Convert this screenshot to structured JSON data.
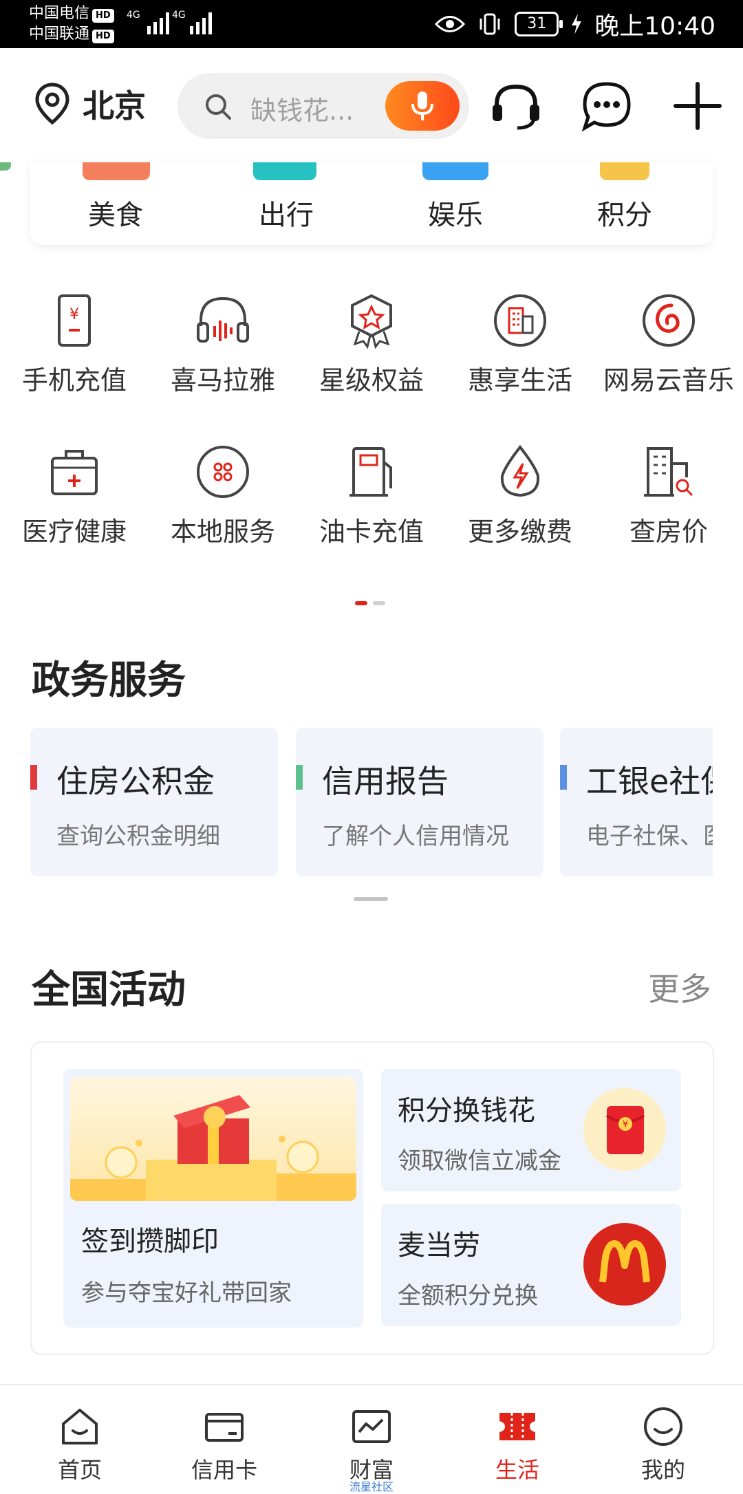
{
  "status_bar": {
    "carrier1": "中国电信",
    "carrier2": "中国联通",
    "hd": "HD",
    "net1": "4G",
    "net2": "4G",
    "battery": "31",
    "time": "晚上10:40"
  },
  "header": {
    "location": "北京",
    "search_placeholder": "缺钱花...",
    "icons": [
      "location-pin-icon",
      "search-icon",
      "mic-icon",
      "headset-icon",
      "chat-bubble-icon",
      "plus-icon"
    ]
  },
  "top_categories": [
    "美食",
    "出行",
    "娱乐",
    "积分"
  ],
  "services_row1": [
    {
      "label": "手机充值",
      "icon": "phone-recharge-icon"
    },
    {
      "label": "喜马拉雅",
      "icon": "headphones-icon"
    },
    {
      "label": "星级权益",
      "icon": "star-badge-icon"
    },
    {
      "label": "惠享生活",
      "icon": "building-icon"
    },
    {
      "label": "网易云音乐",
      "icon": "netease-music-icon"
    }
  ],
  "services_row2": [
    {
      "label": "医疗健康",
      "icon": "medical-kit-icon"
    },
    {
      "label": "本地服务",
      "icon": "grid-circle-icon"
    },
    {
      "label": "油卡充值",
      "icon": "fuel-pump-icon"
    },
    {
      "label": "更多缴费",
      "icon": "lightning-drop-icon"
    },
    {
      "label": "查房价",
      "icon": "house-search-icon"
    }
  ],
  "gov_section": {
    "title": "政务服务",
    "cards": [
      {
        "title": "住房公积金",
        "subtitle": "查询公积金明细",
        "accent": "#e2393b"
      },
      {
        "title": "信用报告",
        "subtitle": "了解个人信用情况",
        "accent": "#5cc08a"
      },
      {
        "title": "工银e社保",
        "subtitle": "电子社保、医保",
        "accent": "#5b8fe0"
      }
    ]
  },
  "activities": {
    "title": "全国活动",
    "more": "更多",
    "main": {
      "title": "签到攒脚印",
      "subtitle": "参与夺宝好礼带回家"
    },
    "items": [
      {
        "title": "积分换钱花",
        "subtitle": "领取微信立减金",
        "icon": "red-envelope-icon"
      },
      {
        "title": "麦当劳",
        "subtitle": "全额积分兑换",
        "icon": "mcdonalds-logo-icon"
      }
    ]
  },
  "bottom_nav": [
    {
      "label": "首页",
      "icon": "home-icon"
    },
    {
      "label": "信用卡",
      "icon": "credit-card-icon"
    },
    {
      "label": "财富",
      "icon": "wealth-chart-icon",
      "sub": "流星社区"
    },
    {
      "label": "生活",
      "icon": "life-ticket-icon",
      "active": true
    },
    {
      "label": "我的",
      "icon": "profile-smile-icon"
    }
  ],
  "colors": {
    "accent": "#e2231a",
    "search_bg": "#f0f0f0",
    "card_bg": "#f1f4fa"
  }
}
